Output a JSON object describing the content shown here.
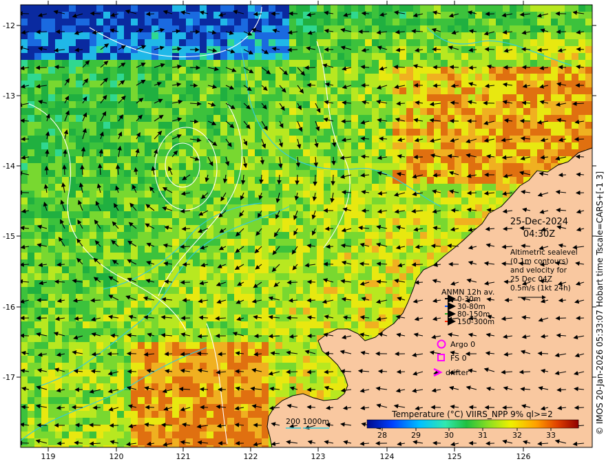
{
  "map": {
    "lon_ticks": [
      "119",
      "120",
      "121",
      "122",
      "123",
      "124",
      "125",
      "126"
    ],
    "lat_ticks": [
      "-12",
      "-13",
      "-14",
      "-15",
      "-16",
      "-17"
    ],
    "date": "25-Dec-2024",
    "time": "04:30Z",
    "description_lines": [
      "Altimetric sealevel",
      "(0.1m contours)",
      "and velocity for",
      "25 Dec 04Z",
      "0.5m/s (1kt 24h)"
    ],
    "anmn": {
      "title": "ANMN 12h av.",
      "items": [
        {
          "label": "0-30m",
          "color": "#000000"
        },
        {
          "label": "30-80m",
          "color": "#0055ff"
        },
        {
          "label": "80-150m",
          "color": "#22aa22"
        },
        {
          "label": "150-300m",
          "color": "#ff2200"
        }
      ]
    },
    "markers": {
      "argo": "Argo 0",
      "fs": "FS 0",
      "drifter": "drifter",
      "marker_color": "#ff00ff"
    },
    "isobath_legend": "200  1000m",
    "isobath_color": "#33ccdd",
    "colorbar": {
      "title": "Temperature (°C) VIIRS_NPP 9% ql>=2",
      "ticks": [
        "28",
        "29",
        "30",
        "31",
        "32",
        "33"
      ]
    },
    "credit": "© IMOS 20-Jan-2026 05:33:07 Hobart time Tscale=CARS+[-1 3]",
    "land_color": "#f9c8a0"
  }
}
